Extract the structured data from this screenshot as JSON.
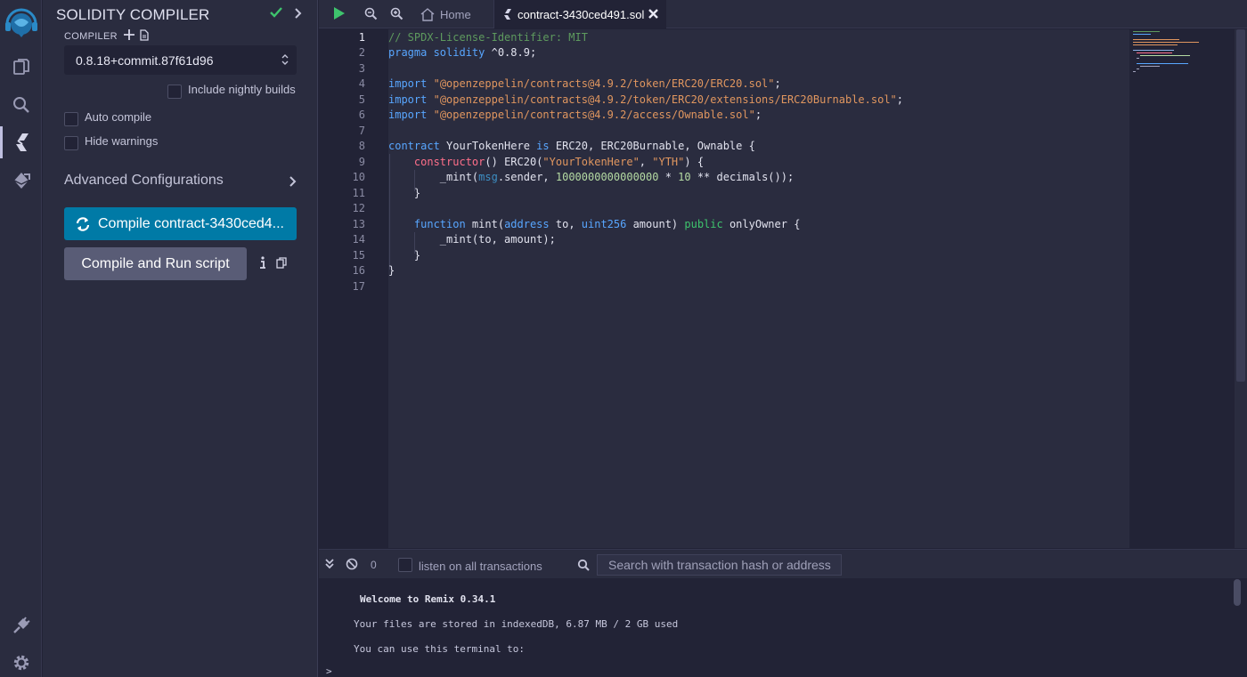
{
  "panel": {
    "title": "SOLIDITY COMPILER",
    "compiler_label": "COMPILER",
    "version": "0.8.18+commit.87f61d96",
    "include_nightly": "Include nightly builds",
    "auto_compile": "Auto compile",
    "hide_warnings": "Hide warnings",
    "advanced": "Advanced Configurations",
    "compile_button": "Compile contract-3430ced4...",
    "run_button": "Compile and Run script"
  },
  "tabs": {
    "home": "Home",
    "active": "contract-3430ced491.sol"
  },
  "editor": {
    "line_numbers": [
      "1",
      "2",
      "3",
      "4",
      "5",
      "6",
      "7",
      "8",
      "9",
      "10",
      "11",
      "12",
      "13",
      "14",
      "15",
      "16",
      "17"
    ],
    "code": {
      "l1": "// SPDX-License-Identifier: MIT",
      "l2_kw": "pragma solidity",
      "l2_rest": " ^0.8.9;",
      "import_kw": "import",
      "l4_str": "\"@openzeppelin/contracts@4.9.2/token/ERC20/ERC20.sol\"",
      "l5_str": "\"@openzeppelin/contracts@4.9.2/token/ERC20/extensions/ERC20Burnable.sol\"",
      "l6_str": "\"@openzeppelin/contracts@4.9.2/access/Ownable.sol\"",
      "semicolon": ";",
      "l8_kw": "contract",
      "l8_name": " YourTokenHere ",
      "l8_is": "is",
      "l8_rest": " ERC20, ERC20Burnable, Ownable {",
      "l9_kw": "constructor",
      "l9_mid": "() ERC20(",
      "l9_s1": "\"YourTokenHere\"",
      "l9_comma": ", ",
      "l9_s2": "\"YTH\"",
      "l9_end": ") {",
      "l10_a": "_mint(",
      "l10_msg": "msg",
      "l10_b": ".sender, ",
      "l10_num": "1000000000000000",
      "l10_c": " * ",
      "l10_ten": "10",
      "l10_d": " ** decimals());",
      "close_brace": "}",
      "l13_kw": "function",
      "l13_a": " mint(",
      "l13_addr": "address",
      "l13_b": " to, ",
      "l13_uint": "uint256",
      "l13_c": " amount) ",
      "l13_pub": "public",
      "l13_d": " onlyOwner {",
      "l14": "_mint(to, amount);"
    }
  },
  "terminal": {
    "count": "0",
    "listen": "listen on all transactions",
    "search_placeholder": "Search with transaction hash or address",
    "welcome": "Welcome to Remix 0.34.1",
    "storage": "Your files are stored in indexedDB, 6.87 MB / 2 GB used",
    "use": "You can use this terminal to:",
    "prompt": ">"
  },
  "icons": {
    "logo": "remix-logo-icon",
    "file_explorer": "files-icon",
    "search": "search-icon",
    "compiler": "solidity-compiler-icon",
    "deploy": "deploy-icon",
    "plugin": "plug-icon",
    "settings": "gear-icon"
  },
  "colors": {
    "accent": "#007aa6",
    "success": "#3ec46d",
    "background": "#222336",
    "panel": "#2a2c3f"
  }
}
